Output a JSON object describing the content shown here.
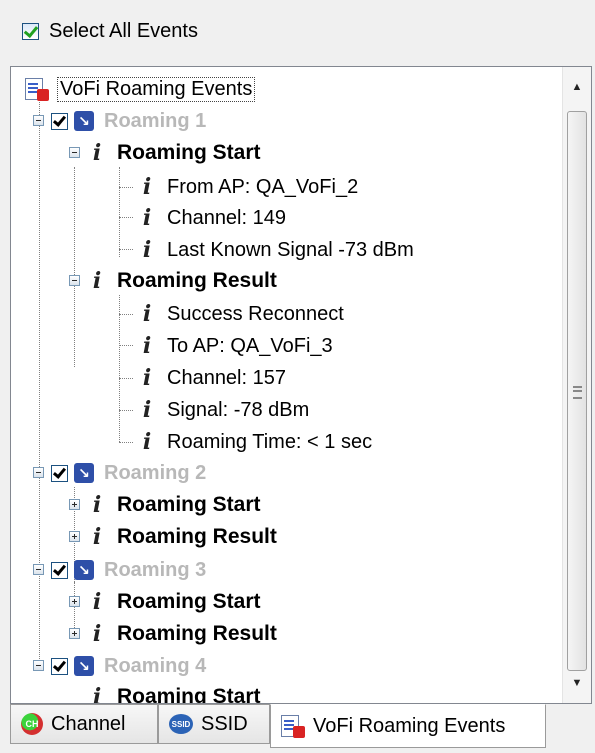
{
  "select_all": {
    "label": "Select All Events",
    "checked": true
  },
  "tree": {
    "root_label": "VoFi Roaming Events",
    "roaming1": {
      "label": "Roaming 1",
      "start_label": "Roaming Start",
      "start_children": [
        "From AP: QA_VoFi_2",
        "Channel: 149",
        "Last Known Signal -73 dBm"
      ],
      "result_label": "Roaming Result",
      "result_children": [
        "Success Reconnect",
        "To AP: QA_VoFi_3",
        "Channel: 157",
        "Signal: -78 dBm",
        "Roaming Time: < 1 sec"
      ]
    },
    "roaming2": {
      "label": "Roaming 2",
      "start_label": "Roaming Start",
      "result_label": "Roaming Result"
    },
    "roaming3": {
      "label": "Roaming 3",
      "start_label": "Roaming Start",
      "result_label": "Roaming Result"
    },
    "roaming4": {
      "label": "Roaming 4",
      "start_label": "Roaming Start"
    }
  },
  "tabs": [
    {
      "label": "Channel",
      "icon": "channel-icon",
      "icon_text": "CH"
    },
    {
      "label": "SSID",
      "icon": "ssid-icon",
      "icon_text": "SSID"
    },
    {
      "label": "VoFi Roaming Events",
      "icon": "vofi-events-icon",
      "active": true
    }
  ]
}
